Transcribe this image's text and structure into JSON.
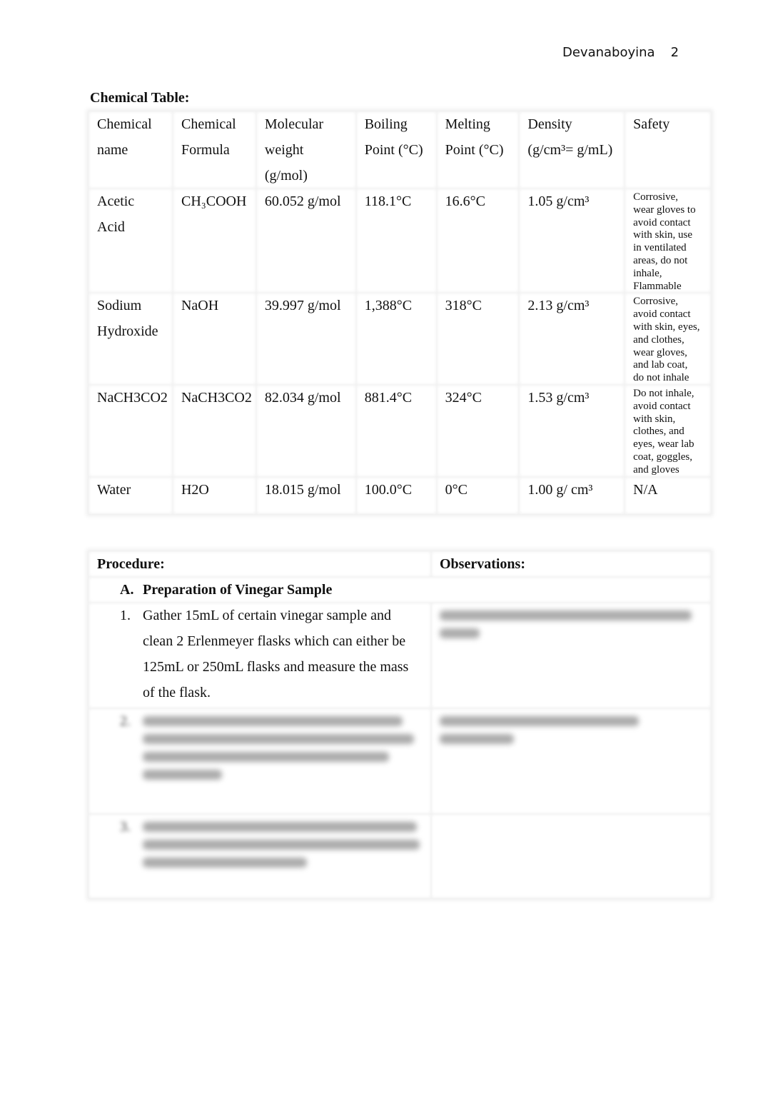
{
  "header": {
    "author": "Devanaboyina",
    "page_number": "2"
  },
  "chemical_table": {
    "title": "Chemical Table:",
    "columns": [
      [
        "Chemical",
        "name"
      ],
      [
        "Chemical",
        "Formula"
      ],
      [
        "Molecular",
        "weight",
        "(g/mol)"
      ],
      [
        "Boiling",
        "Point (°C)"
      ],
      [
        "Melting",
        "Point (°C)"
      ],
      [
        "Density",
        "(g/cm³= g/mL)"
      ],
      [
        "Safety"
      ]
    ],
    "rows": [
      {
        "name": [
          "Acetic",
          "Acid"
        ],
        "formula": "CH₃COOH",
        "molecular_weight": "60.052 g/mol",
        "boiling_point": "118.1°C",
        "melting_point": "16.6°C",
        "density": "1.05 g/cm³",
        "safety": [
          "Corrosive,",
          "wear gloves to",
          "avoid contact",
          "with skin, use",
          "in ventilated",
          "areas, do not",
          "inhale,",
          "Flammable"
        ]
      },
      {
        "name": [
          "Sodium",
          "Hydroxide"
        ],
        "formula": "NaOH",
        "molecular_weight": "39.997 g/mol",
        "boiling_point": "1,388°C",
        "melting_point": "318°C",
        "density": "2.13 g/cm³",
        "safety": [
          "Corrosive,",
          "avoid contact",
          "with skin, eyes,",
          "and clothes,",
          "wear gloves,",
          "and lab coat,",
          "do not inhale"
        ]
      },
      {
        "name": [
          "NaCH3CO2"
        ],
        "formula": "NaCH3CO2",
        "molecular_weight": "82.034 g/mol",
        "boiling_point": "881.4°C",
        "melting_point": "324°C",
        "density": "1.53 g/cm³",
        "safety": [
          "Do not inhale,",
          "avoid contact",
          "with skin,",
          "clothes, and",
          "eyes, wear lab",
          "coat, goggles,",
          "and gloves"
        ]
      },
      {
        "name": [
          "Water"
        ],
        "formula": "H2O",
        "molecular_weight": "18.015 g/mol",
        "boiling_point": "100.0°C",
        "melting_point": "0°C",
        "density": "1.00 g/ cm³",
        "safety": [
          "N/A"
        ]
      }
    ]
  },
  "procedure_table": {
    "procedure_heading": "Procedure:",
    "observations_heading": "Observations:",
    "section": {
      "letter": "A.",
      "title": "Preparation of Vinegar Sample"
    },
    "steps": [
      {
        "number": "1.",
        "lines": [
          "Gather 15mL of certain vinegar sample and",
          "clean 2 Erlenmeyer flasks which can either be",
          "125mL or 250mL flasks and measure the mass",
          "of the flask."
        ],
        "observation_blurred": true
      },
      {
        "number": "2.",
        "blurred": true,
        "observation_blurred": true
      },
      {
        "number": "3.",
        "blurred": true,
        "observation_blurred": false
      }
    ]
  }
}
